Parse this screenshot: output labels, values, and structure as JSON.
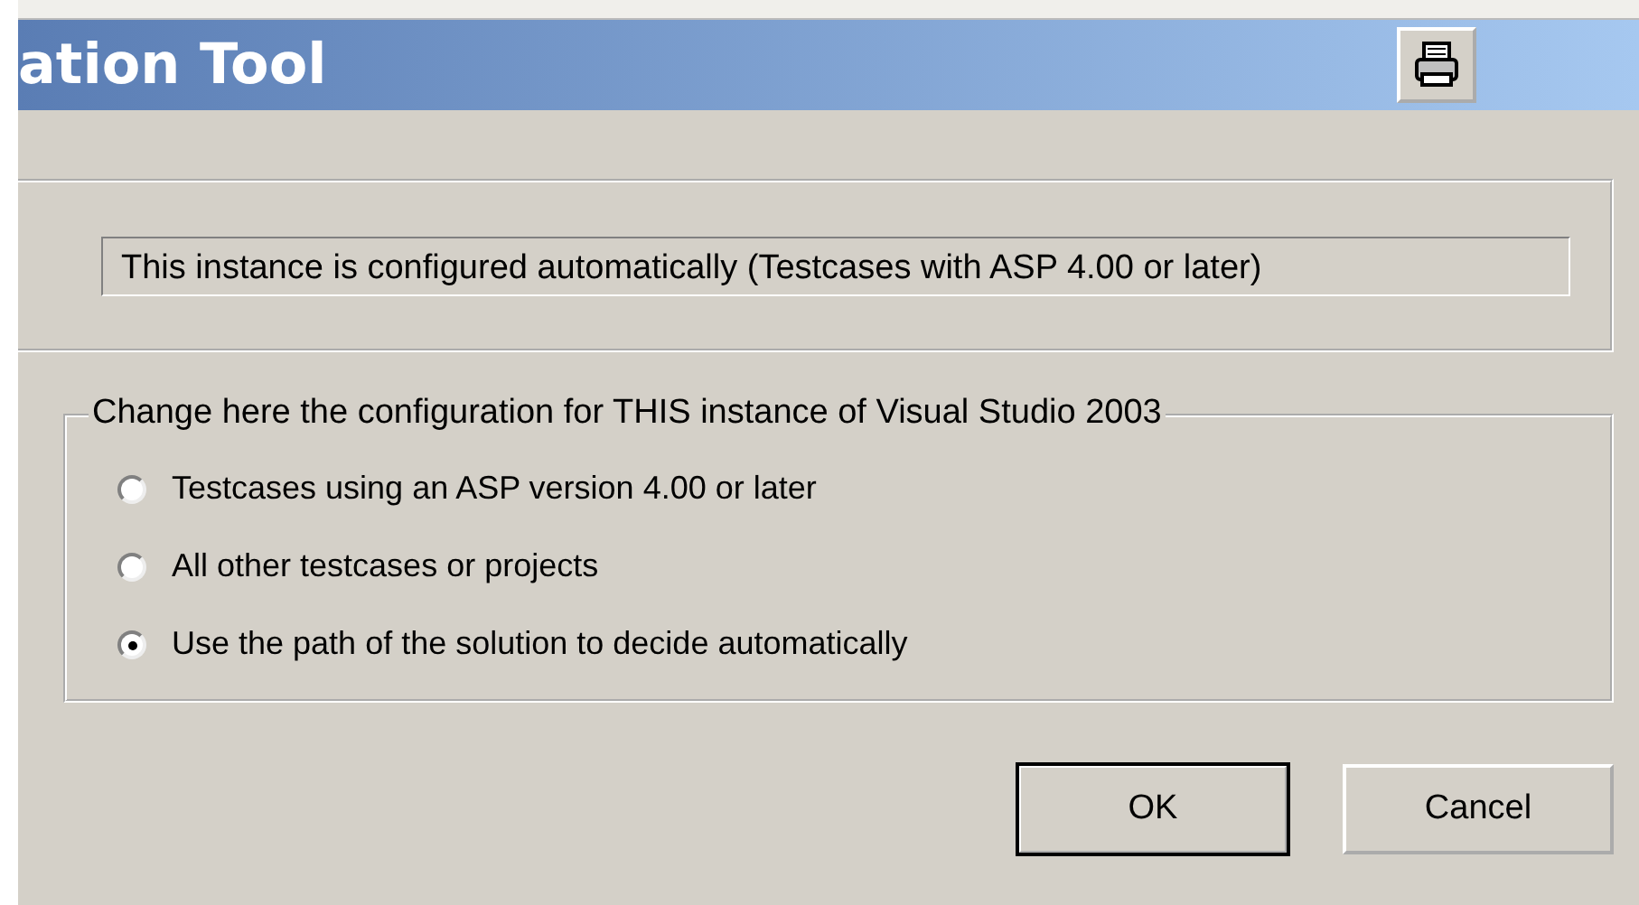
{
  "window": {
    "title": "ation Tool"
  },
  "status_panel": {
    "text": "This instance is configured automatically (Testcases with ASP 4.00 or later)"
  },
  "config_group": {
    "legend": "Change here the configuration for THIS instance of Visual Studio 2003",
    "options": [
      {
        "label": "Testcases using an ASP version 4.00 or later",
        "selected": false
      },
      {
        "label": "All other testcases or projects",
        "selected": false
      },
      {
        "label": "Use the path of the solution to decide automatically",
        "selected": true
      }
    ]
  },
  "buttons": [
    {
      "label": "OK",
      "default": true
    },
    {
      "label": "Cancel",
      "default": false
    }
  ]
}
